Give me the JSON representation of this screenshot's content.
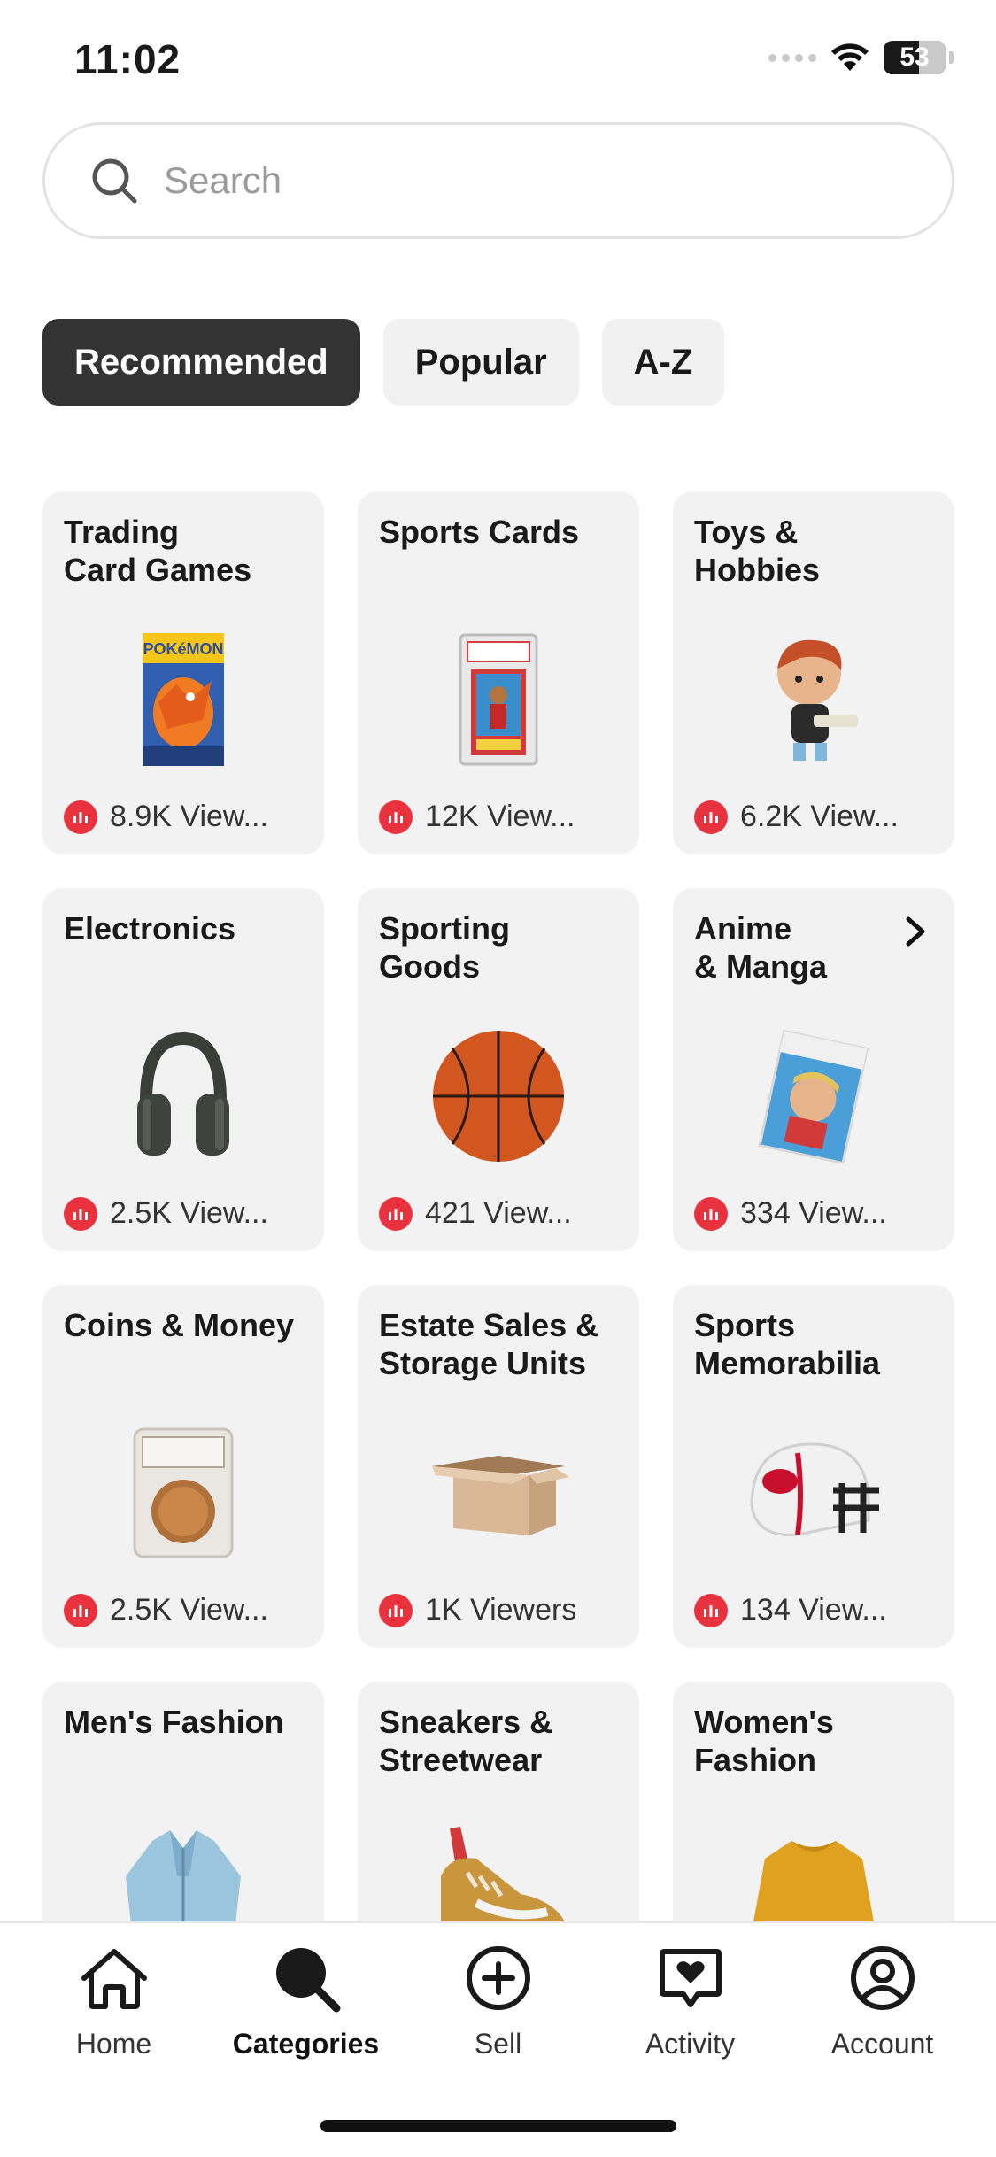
{
  "status_bar": {
    "time": "11:02",
    "battery": "53"
  },
  "search": {
    "placeholder": "Search",
    "icon": "search-icon"
  },
  "tabs": [
    {
      "label": "Recommended",
      "active": true
    },
    {
      "label": "Popular",
      "active": false
    },
    {
      "label": "A-Z",
      "active": false
    }
  ],
  "categories": [
    {
      "title": "Trading\nCard Games",
      "viewers": "8.9K View...",
      "icon": "pokemon-pack-image"
    },
    {
      "title": "Sports Cards",
      "viewers": "12K View...",
      "icon": "graded-card-image"
    },
    {
      "title": "Toys &\nHobbies",
      "viewers": "6.2K View...",
      "icon": "vinyl-figure-image"
    },
    {
      "title": "Electronics",
      "viewers": "2.5K View...",
      "icon": "headphones-image"
    },
    {
      "title": "Sporting\nGoods",
      "viewers": "421 View...",
      "icon": "basketball-image"
    },
    {
      "title": "Anime\n& Manga",
      "viewers": "334 View...",
      "icon": "manga-book-image"
    },
    {
      "title": "Coins & Money",
      "viewers": "2.5K View...",
      "icon": "graded-coin-image"
    },
    {
      "title": "Estate Sales &\nStorage Units",
      "viewers": "1K Viewers",
      "icon": "cardboard-box-image"
    },
    {
      "title": "Sports\nMemorabilia",
      "viewers": "134 View...",
      "icon": "football-helmet-image"
    },
    {
      "title": "Men's Fashion",
      "viewers": "",
      "icon": "jacket-image"
    },
    {
      "title": "Sneakers &\nStreetwear",
      "viewers": "",
      "icon": "sneaker-image"
    },
    {
      "title": "Women's\nFashion",
      "viewers": "",
      "icon": "sweater-image"
    }
  ],
  "bottom_nav": [
    {
      "label": "Home",
      "icon": "home-icon",
      "active": false
    },
    {
      "label": "Categories",
      "icon": "categories-search-icon",
      "active": true
    },
    {
      "label": "Sell",
      "icon": "plus-circle-icon",
      "active": false
    },
    {
      "label": "Activity",
      "icon": "heart-chat-icon",
      "active": false
    },
    {
      "label": "Account",
      "icon": "account-icon",
      "active": false
    }
  ],
  "colors": {
    "live": "#e8323d",
    "active_tab": "#333333",
    "card_bg": "#f2f2f2"
  }
}
